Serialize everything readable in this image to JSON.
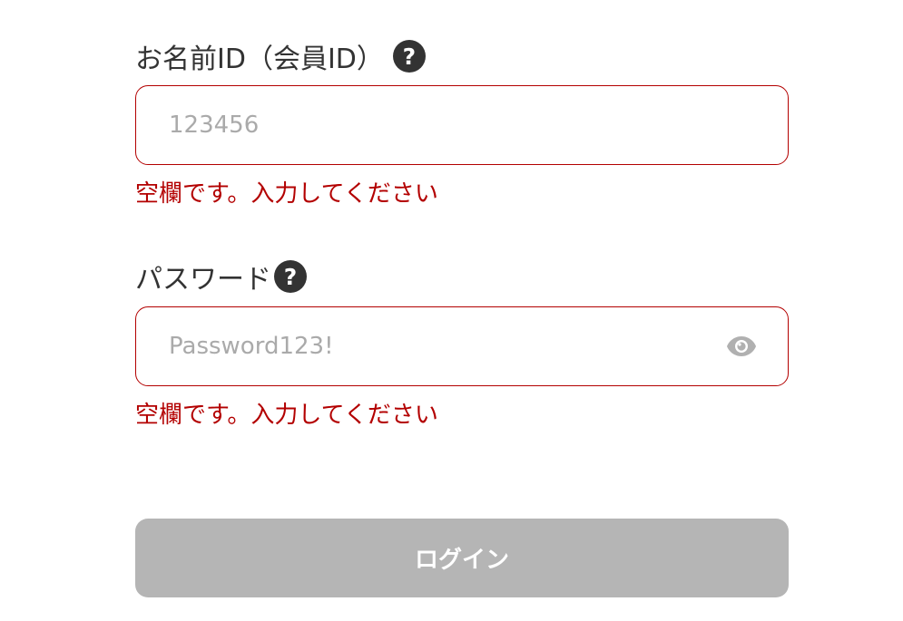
{
  "member_id": {
    "label": "お名前ID（会員ID）",
    "help_icon": "question-circle-icon",
    "placeholder": "123456",
    "value": "",
    "error": "空欄です。入力してください"
  },
  "password": {
    "label": "パスワード",
    "help_icon": "question-circle-icon",
    "placeholder": "Password123!",
    "value": "",
    "toggle_icon": "eye-icon",
    "error": "空欄です。入力してください"
  },
  "login_button": {
    "label": "ログイン",
    "state": "disabled"
  },
  "colors": {
    "error": "#b30000",
    "text": "#333333",
    "placeholder": "#aaaaaa",
    "button_disabled": "#b5b5b5",
    "icon_bg": "#333333",
    "eye_icon": "#b0b0b0"
  }
}
